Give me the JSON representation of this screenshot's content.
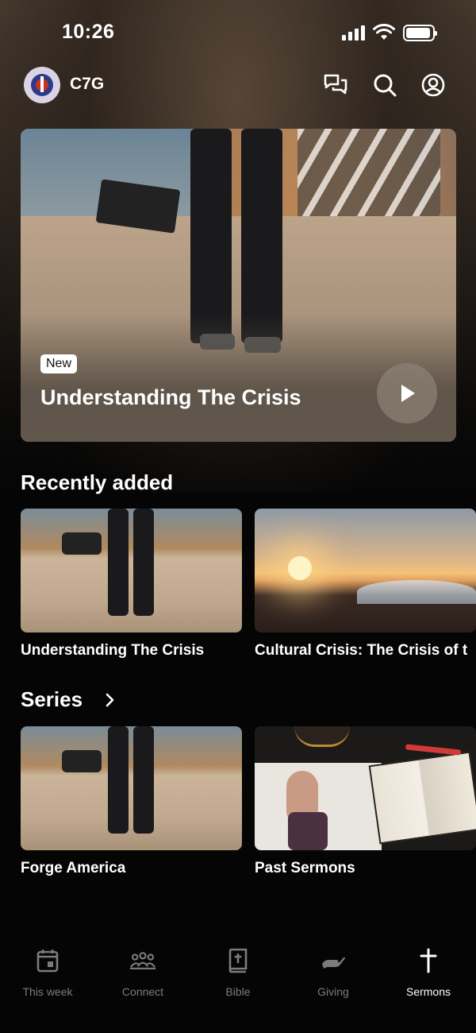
{
  "status_bar": {
    "time": "10:26",
    "battery_level": 0.95
  },
  "header": {
    "app_name": "C7G"
  },
  "hero": {
    "badge": "New",
    "title": "Understanding The Crisis"
  },
  "recently_added": {
    "title": "Recently added",
    "items": [
      {
        "title": "Understanding The Crisis"
      },
      {
        "title": "Cultural Crisis: The Crisis of t"
      }
    ]
  },
  "series": {
    "title": "Series",
    "items": [
      {
        "title": "Forge America"
      },
      {
        "title": "Past Sermons"
      }
    ]
  },
  "tabs": [
    {
      "label": "This week",
      "icon": "calendar-icon"
    },
    {
      "label": "Connect",
      "icon": "people-icon"
    },
    {
      "label": "Bible",
      "icon": "bible-icon"
    },
    {
      "label": "Giving",
      "icon": "giving-hand-icon"
    },
    {
      "label": "Sermons",
      "icon": "cross-icon",
      "active": true
    }
  ],
  "colors": {
    "background": "#050505",
    "active_tab": "#ffffff",
    "inactive_tab": "#7c7c7c"
  }
}
